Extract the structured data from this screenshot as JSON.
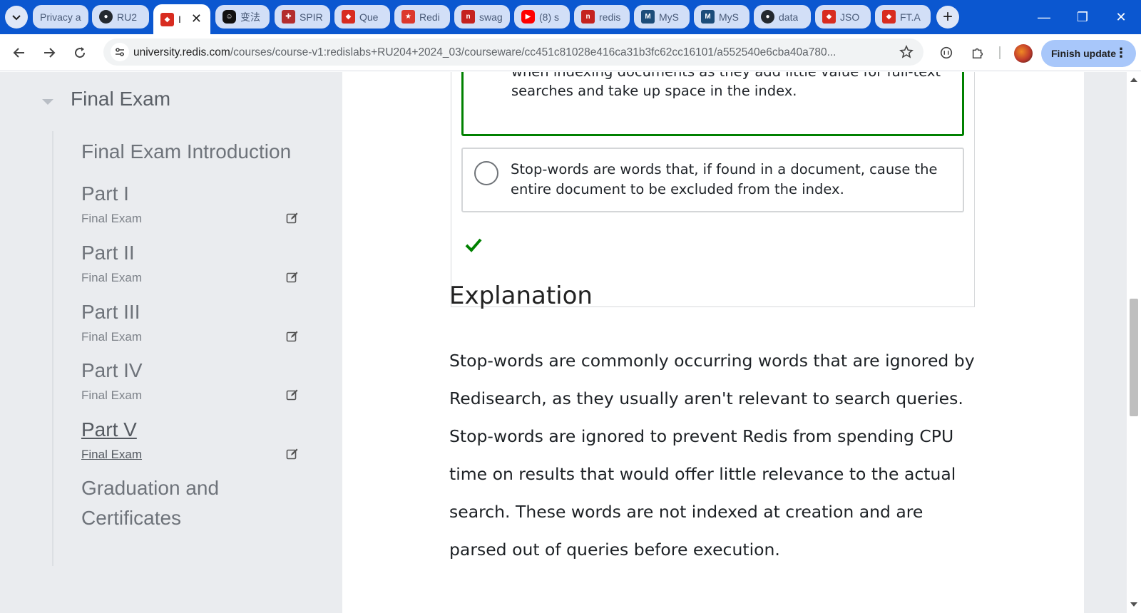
{
  "browser": {
    "tabs": [
      {
        "label": "Privacy a",
        "icon": "blank-page-icon",
        "color": "#ffffff"
      },
      {
        "label": "RU2",
        "icon": "github-icon",
        "color": "#24292f"
      },
      {
        "label": "I",
        "icon": "redis-cube-icon",
        "color": "#d82c20",
        "active": true
      },
      {
        "label": "变法",
        "icon": "chat-bot-icon",
        "color": "#111111"
      },
      {
        "label": "SPIR",
        "icon": "shield-crest-icon",
        "color": "#b32d2d"
      },
      {
        "label": "Que",
        "icon": "redis-cube-icon",
        "color": "#d82c20"
      },
      {
        "label": "Redi",
        "icon": "redis-logo-icon",
        "color": "#dc382d"
      },
      {
        "label": "swag",
        "icon": "n-logo-icon",
        "color": "#c5221f"
      },
      {
        "label": "(8) s",
        "icon": "youtube-icon",
        "color": "#ff0000"
      },
      {
        "label": "redis",
        "icon": "n-logo-icon",
        "color": "#c5221f"
      },
      {
        "label": "MyS",
        "icon": "mysql-icon",
        "color": "#1c4d7a"
      },
      {
        "label": "MyS",
        "icon": "mysql-icon",
        "color": "#1c4d7a"
      },
      {
        "label": "data",
        "icon": "github-icon",
        "color": "#24292f"
      },
      {
        "label": "JSO",
        "icon": "redis-cube-icon",
        "color": "#d82c20"
      },
      {
        "label": "FT.A",
        "icon": "redis-cube-icon",
        "color": "#d82c20"
      }
    ],
    "url_host": "university.redis.com",
    "url_path": "/courses/course-v1:redislabs+RU204+2024_03/courseware/cc451c81028e416ca31b3fc62cc16101/a552540e6cba40a780...",
    "finish_update_label": "Finish update",
    "accent_color": "#0b57d0"
  },
  "sidebar": {
    "section_title": "Final Exam",
    "items": [
      {
        "title": "Final Exam Introduction",
        "subtitle": ""
      },
      {
        "title": "Part I",
        "subtitle": "Final Exam"
      },
      {
        "title": "Part II",
        "subtitle": "Final Exam"
      },
      {
        "title": "Part III",
        "subtitle": "Final Exam"
      },
      {
        "title": "Part IV",
        "subtitle": "Final Exam"
      },
      {
        "title": "Part V",
        "subtitle": "Final Exam"
      },
      {
        "title": "Graduation and Certificates",
        "subtitle": ""
      }
    ]
  },
  "problem": {
    "options": [
      {
        "text": "Stop-words are commonly occurring words that are discarded when indexing documents as they add little value for full-text searches and take up space in the index.",
        "selected": true,
        "correct": true
      },
      {
        "text": "Stop-words are words that, if found in a document, cause the entire document to be excluded from the index.",
        "selected": false,
        "correct": false
      }
    ],
    "status_icon": "checkmark-icon",
    "status_color": "#008100"
  },
  "explanation": {
    "heading": "Explanation",
    "body": "Stop-words are commonly occurring words that are ignored by Redisearch, as they usually aren't relevant to search queries. Stop-words are ignored to prevent Redis from spending CPU time on results that would offer little relevance to the actual search. These words are not indexed at creation and are parsed out of queries before execution."
  }
}
